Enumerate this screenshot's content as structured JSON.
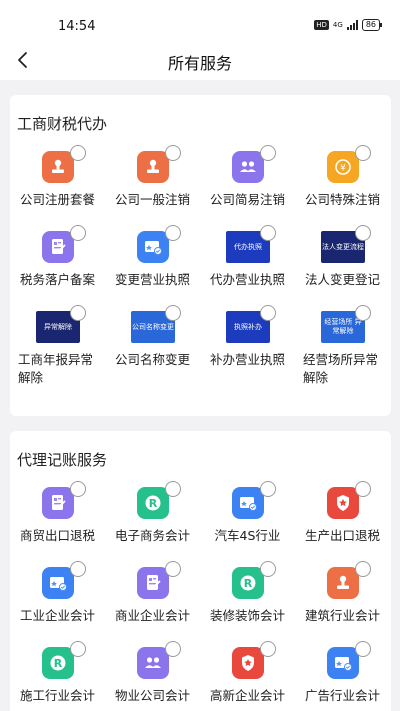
{
  "status": {
    "time": "14:54",
    "hd": "HD",
    "network": "4G",
    "battery": "86"
  },
  "nav": {
    "title": "所有服务"
  },
  "sections": [
    {
      "title": "工商财税代办",
      "items": [
        {
          "label": "公司注册套餐",
          "icon": "stamp-icon",
          "color": "#ec6f45"
        },
        {
          "label": "公司一般注销",
          "icon": "stamp-icon",
          "color": "#ec6f45"
        },
        {
          "label": "公司简易注销",
          "icon": "people-icon",
          "color": "#8c74ec"
        },
        {
          "label": "公司特殊注销",
          "icon": "coin-icon",
          "color": "#f5a623"
        },
        {
          "label": "税务落户备案",
          "icon": "document-icon",
          "color": "#8c74ec"
        },
        {
          "label": "变更营业执照",
          "icon": "license-icon",
          "color": "#3d82f3"
        },
        {
          "label": "代办营业执照",
          "icon": "banner-icon",
          "color": "#1c3bbd",
          "banner": "代办执照"
        },
        {
          "label": "法人变更登记",
          "icon": "banner-icon",
          "color": "#1a2670",
          "banner": "法人变更流程"
        },
        {
          "label": "工商年报异常解除",
          "icon": "banner-icon",
          "color": "#1a2670",
          "banner": "异常解除"
        },
        {
          "label": "公司名称变更",
          "icon": "banner-icon",
          "color": "#2a67d8",
          "banner": "公司名称变更"
        },
        {
          "label": "补办营业执照",
          "icon": "banner-icon",
          "color": "#1c3bbd",
          "banner": "执照补办"
        },
        {
          "label": "经营场所异常解除",
          "icon": "banner-icon",
          "color": "#2a67d8",
          "banner": "经营场所 异常解除"
        }
      ]
    },
    {
      "title": "代理记账服务",
      "items": [
        {
          "label": "商贸出口退税",
          "icon": "document-icon",
          "color": "#8c74ec"
        },
        {
          "label": "电子商务会计",
          "icon": "r-badge-icon",
          "color": "#26c08c"
        },
        {
          "label": "汽车4S行业",
          "icon": "license-icon",
          "color": "#3d82f3"
        },
        {
          "label": "生产出口退税",
          "icon": "shield-star-icon",
          "color": "#e9493d"
        },
        {
          "label": "工业企业会计",
          "icon": "license-icon",
          "color": "#3d82f3"
        },
        {
          "label": "商业企业会计",
          "icon": "document-icon",
          "color": "#8c74ec"
        },
        {
          "label": "装修装饰会计",
          "icon": "r-badge-icon",
          "color": "#26c08c"
        },
        {
          "label": "建筑行业会计",
          "icon": "stamp-icon",
          "color": "#ec6f45"
        },
        {
          "label": "施工行业会计",
          "icon": "r-badge-icon",
          "color": "#26c08c"
        },
        {
          "label": "物业公司会计",
          "icon": "people-icon",
          "color": "#8c74ec"
        },
        {
          "label": "高新企业会计",
          "icon": "shield-star-icon",
          "color": "#e9493d"
        },
        {
          "label": "广告行业会计",
          "icon": "license-icon",
          "color": "#3d82f3"
        }
      ]
    }
  ]
}
